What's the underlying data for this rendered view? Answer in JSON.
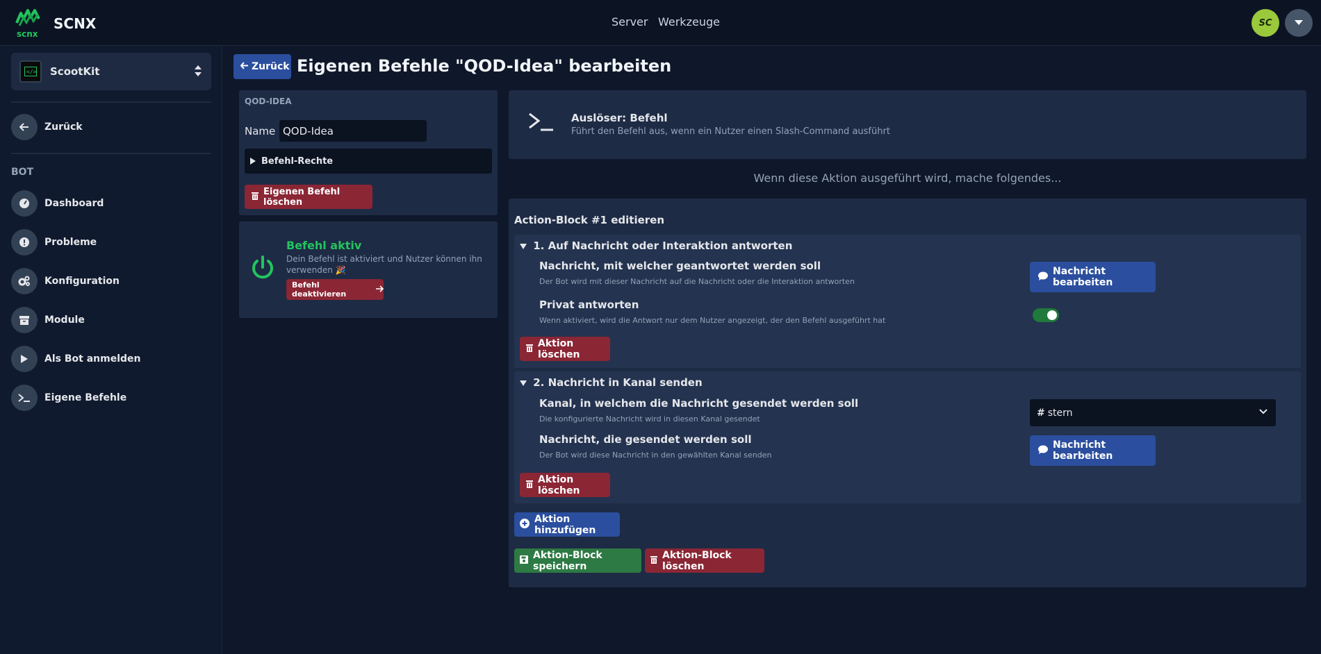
{
  "app": {
    "logo_text": "scnx",
    "brand": "SCNX",
    "nav": [
      "Server",
      "Werkzeuge"
    ],
    "avatar_initials": "SC"
  },
  "sidebar": {
    "bot_name": "ScootKit",
    "back_label": "Zurück",
    "section_label": "BOT",
    "items": [
      {
        "label": "Dashboard",
        "icon": "gauge-icon"
      },
      {
        "label": "Probleme",
        "icon": "alert-icon"
      },
      {
        "label": "Konfiguration",
        "icon": "gears-icon"
      },
      {
        "label": "Module",
        "icon": "box-icon"
      },
      {
        "label": "Als Bot anmelden",
        "icon": "play-icon"
      },
      {
        "label": "Eigene Befehle",
        "icon": "terminal-icon"
      }
    ]
  },
  "header": {
    "back_label": "Zurück",
    "title": "Eigenen Befehle \"QOD-Idea\" bearbeiten"
  },
  "command": {
    "heading": "QOD-IDEA",
    "name_label": "Name",
    "name_value": "QOD-Idea",
    "permissions_label": "Befehl-Rechte",
    "delete_label": "Eigenen Befehl löschen"
  },
  "status": {
    "title": "Befehl aktiv",
    "description": "Dein Befehl ist aktiviert und Nutzer können ihn verwenden 🎉",
    "deactivate_label": "Befehl deaktivieren"
  },
  "trigger": {
    "title": "Auslöser: Befehl",
    "description": "Führt den Befehl aus, wenn ein Nutzer einen Slash-Command ausführt"
  },
  "then_text": "Wenn diese Aktion ausgeführt wird, mache folgendes...",
  "block": {
    "title": "Action-Block #1 editieren",
    "actions": [
      {
        "title": "1. Auf Nachricht oder Interaktion antworten",
        "fields": [
          {
            "label": "Nachricht, mit welcher geantwortet werden soll",
            "description": "Der Bot wird mit dieser Nachricht auf die Nachricht oder die Interaktion antworten",
            "button": "Nachricht bearbeiten"
          },
          {
            "label": "Privat antworten",
            "description": "Wenn aktiviert, wird die Antwort nur dem Nutzer angezeigt, der den Befehl ausgeführt hat",
            "toggle_on": true
          }
        ],
        "delete_label": "Aktion löschen"
      },
      {
        "title": "2. Nachricht in Kanal senden",
        "fields": [
          {
            "label": "Kanal, in welchem die Nachricht gesendet werden soll",
            "description": "Die konfigurierte Nachricht wird in diesen Kanal gesendet",
            "select_value": "stern",
            "select_prefix": "#"
          },
          {
            "label": "Nachricht, die gesendet werden soll",
            "description": "Der Bot wird diese Nachricht in den gewählten Kanal senden",
            "button": "Nachricht bearbeiten"
          }
        ],
        "delete_label": "Aktion löschen"
      }
    ],
    "add_action_label": "Aktion hinzufügen",
    "save_label": "Aktion-Block speichern",
    "delete_label": "Aktion-Block löschen"
  },
  "colors": {
    "background": "#0f172a",
    "primary": "#2b4f9e",
    "danger": "#8b2635",
    "success": "#2d7a44",
    "active_green": "#22c55e"
  }
}
